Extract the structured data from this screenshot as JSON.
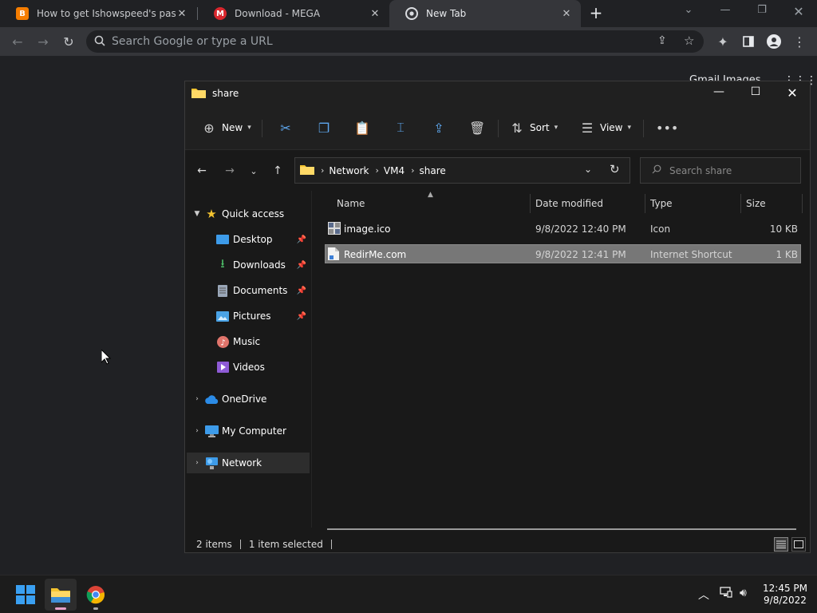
{
  "browser": {
    "tabs": [
      {
        "title": "How to get Ishowspeed's passwo",
        "favicon": "blogger-icon",
        "color": "#f57d00"
      },
      {
        "title": "Download - MEGA",
        "favicon": "mega-icon",
        "color": "#d9272e"
      },
      {
        "title": "New Tab",
        "favicon": "chrome-icon",
        "active": true
      }
    ],
    "omnibox_placeholder": "Search Google or type a URL",
    "ntp_links": "Gmail   Images"
  },
  "explorer": {
    "title": "share",
    "commands": {
      "new": "New",
      "sort": "Sort",
      "view": "View"
    },
    "breadcrumb": [
      "Network",
      "VM4",
      "share"
    ],
    "search_placeholder": "Search share",
    "nav": {
      "quick_access": "Quick access",
      "items": [
        "Desktop",
        "Downloads",
        "Documents",
        "Pictures",
        "Music",
        "Videos"
      ],
      "onedrive": "OneDrive",
      "my_computer": "My Computer",
      "network": "Network"
    },
    "columns": [
      "Name",
      "Date modified",
      "Type",
      "Size"
    ],
    "files": [
      {
        "name": "image.ico",
        "date": "9/8/2022 12:40 PM",
        "type": "Icon",
        "size": "10 KB"
      },
      {
        "name": "RedirMe.com",
        "date": "9/8/2022 12:41 PM",
        "type": "Internet Shortcut",
        "size": "1 KB",
        "selected": true
      }
    ],
    "status": {
      "count": "2 items",
      "selection": "1 item selected"
    }
  },
  "taskbar": {
    "time": "12:45 PM",
    "date": "9/8/2022"
  }
}
